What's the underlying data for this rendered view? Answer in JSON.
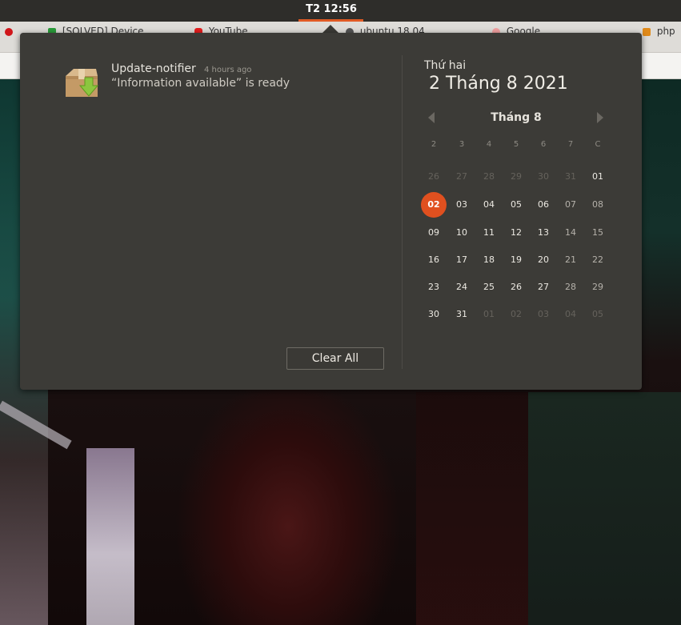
{
  "panel": {
    "clock": "T2 12:56"
  },
  "browser_tabs": [
    {
      "label": "[SOLVED] Device ..."
    },
    {
      "label": "YouTube"
    },
    {
      "label": "ubuntu 18.04 ..."
    },
    {
      "label": "Google ..."
    },
    {
      "label": "php"
    }
  ],
  "notification": {
    "app": "Update-notifier",
    "time": "4 hours ago",
    "body": "“Information available” is ready"
  },
  "clear_all": "Clear All",
  "calendar": {
    "weekday": "Thứ hai",
    "date": "2 Tháng 8 2021",
    "month": "Tháng 8",
    "day_headers": [
      "2",
      "3",
      "4",
      "5",
      "6",
      "7",
      "C"
    ],
    "weeks": [
      [
        {
          "d": "26",
          "in": false
        },
        {
          "d": "27",
          "in": false
        },
        {
          "d": "28",
          "in": false
        },
        {
          "d": "29",
          "in": false
        },
        {
          "d": "30",
          "in": false
        },
        {
          "d": "31",
          "in": false
        },
        {
          "d": "01",
          "in": true
        }
      ],
      [
        {
          "d": "02",
          "in": true,
          "today": true
        },
        {
          "d": "03",
          "in": true
        },
        {
          "d": "04",
          "in": true
        },
        {
          "d": "05",
          "in": true
        },
        {
          "d": "06",
          "in": true
        },
        {
          "d": "07",
          "in": true,
          "dim": true
        },
        {
          "d": "08",
          "in": true,
          "dim": true
        }
      ],
      [
        {
          "d": "09",
          "in": true
        },
        {
          "d": "10",
          "in": true
        },
        {
          "d": "11",
          "in": true
        },
        {
          "d": "12",
          "in": true
        },
        {
          "d": "13",
          "in": true
        },
        {
          "d": "14",
          "in": true,
          "dim": true
        },
        {
          "d": "15",
          "in": true,
          "dim": true
        }
      ],
      [
        {
          "d": "16",
          "in": true
        },
        {
          "d": "17",
          "in": true
        },
        {
          "d": "18",
          "in": true
        },
        {
          "d": "19",
          "in": true
        },
        {
          "d": "20",
          "in": true
        },
        {
          "d": "21",
          "in": true,
          "dim": true
        },
        {
          "d": "22",
          "in": true,
          "dim": true
        }
      ],
      [
        {
          "d": "23",
          "in": true
        },
        {
          "d": "24",
          "in": true
        },
        {
          "d": "25",
          "in": true
        },
        {
          "d": "26",
          "in": true
        },
        {
          "d": "27",
          "in": true
        },
        {
          "d": "28",
          "in": true,
          "dim": true
        },
        {
          "d": "29",
          "in": true,
          "dim": true
        }
      ],
      [
        {
          "d": "30",
          "in": true
        },
        {
          "d": "31",
          "in": true
        },
        {
          "d": "01",
          "in": false
        },
        {
          "d": "02",
          "in": false
        },
        {
          "d": "03",
          "in": false
        },
        {
          "d": "04",
          "in": false
        },
        {
          "d": "05",
          "in": false
        }
      ]
    ]
  },
  "colors": {
    "accent": "#e0501f",
    "popover_bg": "#3c3b37"
  }
}
